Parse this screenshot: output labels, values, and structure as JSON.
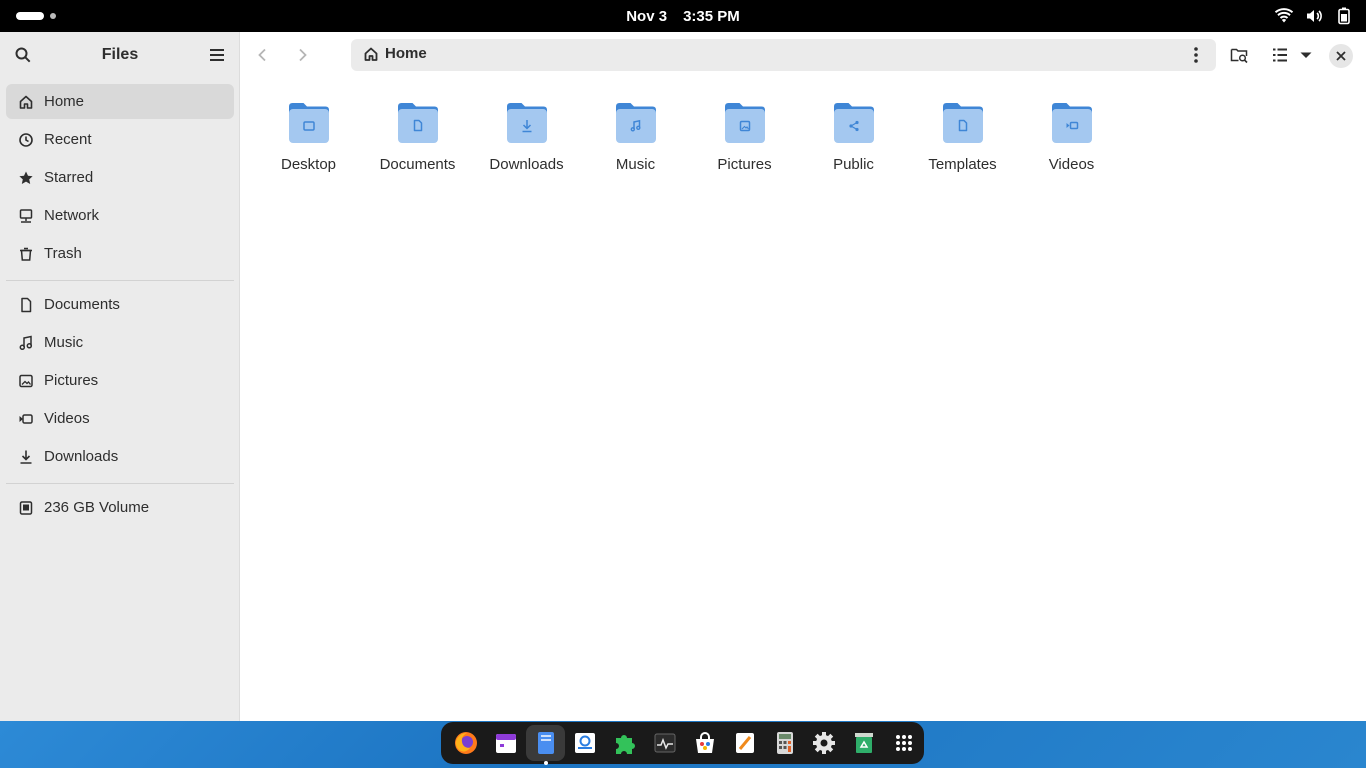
{
  "topbar": {
    "date": "Nov 3",
    "time": "3:35 PM"
  },
  "sidebar": {
    "title": "Files",
    "places": [
      {
        "label": "Home",
        "icon": "home-icon"
      },
      {
        "label": "Recent",
        "icon": "clock-icon"
      },
      {
        "label": "Starred",
        "icon": "star-icon"
      },
      {
        "label": "Network",
        "icon": "network-icon"
      },
      {
        "label": "Trash",
        "icon": "trash-icon"
      }
    ],
    "bookmarks": [
      {
        "label": "Documents",
        "icon": "document-icon"
      },
      {
        "label": "Music",
        "icon": "music-icon"
      },
      {
        "label": "Pictures",
        "icon": "picture-icon"
      },
      {
        "label": "Videos",
        "icon": "video-icon"
      },
      {
        "label": "Downloads",
        "icon": "download-icon"
      }
    ],
    "devices": [
      {
        "label": "236 GB Volume",
        "icon": "drive-icon"
      }
    ]
  },
  "pathbar": {
    "location": "Home"
  },
  "folders": [
    {
      "label": "Desktop",
      "emblem": "desktop"
    },
    {
      "label": "Documents",
      "emblem": "document"
    },
    {
      "label": "Downloads",
      "emblem": "download"
    },
    {
      "label": "Music",
      "emblem": "music"
    },
    {
      "label": "Pictures",
      "emblem": "picture"
    },
    {
      "label": "Public",
      "emblem": "share"
    },
    {
      "label": "Templates",
      "emblem": "template"
    },
    {
      "label": "Videos",
      "emblem": "video"
    }
  ],
  "colors": {
    "folder_body": "#a4c8f0",
    "folder_tab": "#3f86d6",
    "emblem": "#3f86d6",
    "active_row": "#d9d9d9",
    "sidebar_bg": "#ebebeb"
  },
  "dock": {
    "apps": [
      "firefox-icon",
      "calendar-icon",
      "files-icon",
      "text-editor-icon",
      "extensions-icon",
      "system-monitor-icon",
      "software-icon",
      "notes-icon",
      "calculator-icon",
      "settings-icon",
      "recycle-icon",
      "app-grid-icon"
    ],
    "running": "files-icon"
  }
}
